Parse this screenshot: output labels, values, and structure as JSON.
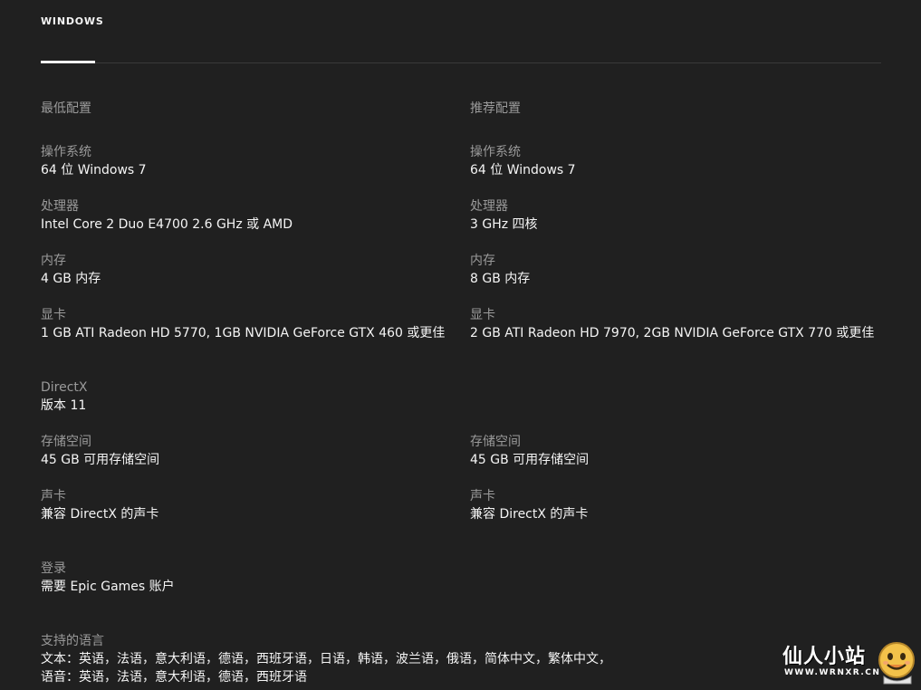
{
  "tabs": [
    {
      "label": "WINDOWS",
      "active": true
    }
  ],
  "columns": {
    "minimum": "最低配置",
    "recommended": "推荐配置"
  },
  "minimum": {
    "os": {
      "label": "操作系统",
      "value": "64 位 Windows 7"
    },
    "cpu": {
      "label": "处理器",
      "value": "Intel Core 2 Duo E4700 2.6 GHz 或 AMD"
    },
    "memory": {
      "label": "内存",
      "value": "4 GB 内存"
    },
    "gpu": {
      "label": "显卡",
      "value": "1 GB ATI Radeon HD 5770, 1GB NVIDIA GeForce GTX 460 或更佳"
    },
    "directx": {
      "label": "DirectX",
      "value": "版本 11"
    },
    "storage": {
      "label": "存储空间",
      "value": "45 GB 可用存储空间"
    },
    "sound": {
      "label": "声卡",
      "value": "兼容 DirectX 的声卡"
    }
  },
  "recommended": {
    "os": {
      "label": "操作系统",
      "value": "64 位 Windows 7"
    },
    "cpu": {
      "label": "处理器",
      "value": "3 GHz 四核"
    },
    "memory": {
      "label": "内存",
      "value": "8 GB 内存"
    },
    "gpu": {
      "label": "显卡",
      "value": "2 GB ATI Radeon HD 7970, 2GB NVIDIA GeForce GTX 770 或更佳"
    },
    "storage": {
      "label": "存储空间",
      "value": "45 GB 可用存储空间"
    },
    "sound": {
      "label": "声卡",
      "value": "兼容 DirectX 的声卡"
    }
  },
  "login": {
    "label": "登录",
    "value": "需要 Epic Games 账户"
  },
  "languages": {
    "label": "支持的语言",
    "text": "文本：英语，法语，意大利语，德语，西班牙语，日语，韩语，波兰语，俄语，简体中文，繁体中文，",
    "audio": "语音：英语，法语，意大利语，德语，西班牙语"
  },
  "watermark": {
    "title": "仙人小站",
    "url": "WWW.WRNXR.CN",
    "icon": "mascot-face-icon"
  },
  "colors": {
    "background": "#202020",
    "label": "#9a9a9a",
    "value": "#f5f5f5",
    "divider": "#3a3a3a"
  }
}
